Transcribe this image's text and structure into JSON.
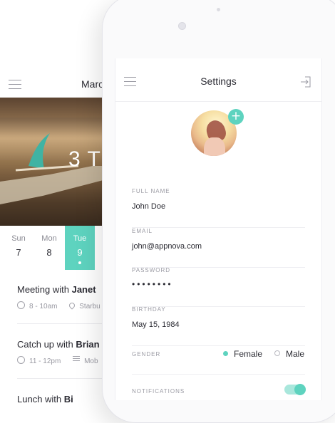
{
  "accent_color": "#5ed3bf",
  "calendar": {
    "month_label": "Marc",
    "hero_text": "3 T",
    "days": [
      {
        "name": "Sun",
        "date": "7",
        "active": false
      },
      {
        "name": "Mon",
        "date": "8",
        "active": false
      },
      {
        "name": "Tue",
        "date": "9",
        "active": true
      }
    ],
    "events": [
      {
        "title_prefix": "Meeting with ",
        "title_name": "Janet",
        "time": "8 - 10am",
        "meta": "Starbu",
        "meta_icon": "location-pin-icon"
      },
      {
        "title_prefix": "Catch up with ",
        "title_name": "Brian",
        "time": "11 - 12pm",
        "meta": "Mob",
        "meta_icon": "notes-icon"
      },
      {
        "title_prefix": "Lunch with ",
        "title_name": "Bi",
        "time": "",
        "meta": "",
        "meta_icon": ""
      }
    ]
  },
  "settings": {
    "title": "Settings",
    "menu_icon": "hamburger-menu-icon",
    "logout_icon": "logout-icon",
    "add_photo_icon": "plus-icon",
    "fields": {
      "full_name": {
        "label": "FULL NAME",
        "value": "John Doe"
      },
      "email": {
        "label": "EMAIL",
        "value": "john@appnova.com"
      },
      "password": {
        "label": "PASSWORD",
        "value": "••••••••"
      },
      "birthday": {
        "label": "BIRTHDAY",
        "value": "May 15, 1984"
      }
    },
    "gender": {
      "label": "GENDER",
      "options": [
        "Female",
        "Male"
      ],
      "selected": "Female"
    },
    "notifications": {
      "label": "NOTIFICATIONS",
      "enabled": true
    }
  }
}
